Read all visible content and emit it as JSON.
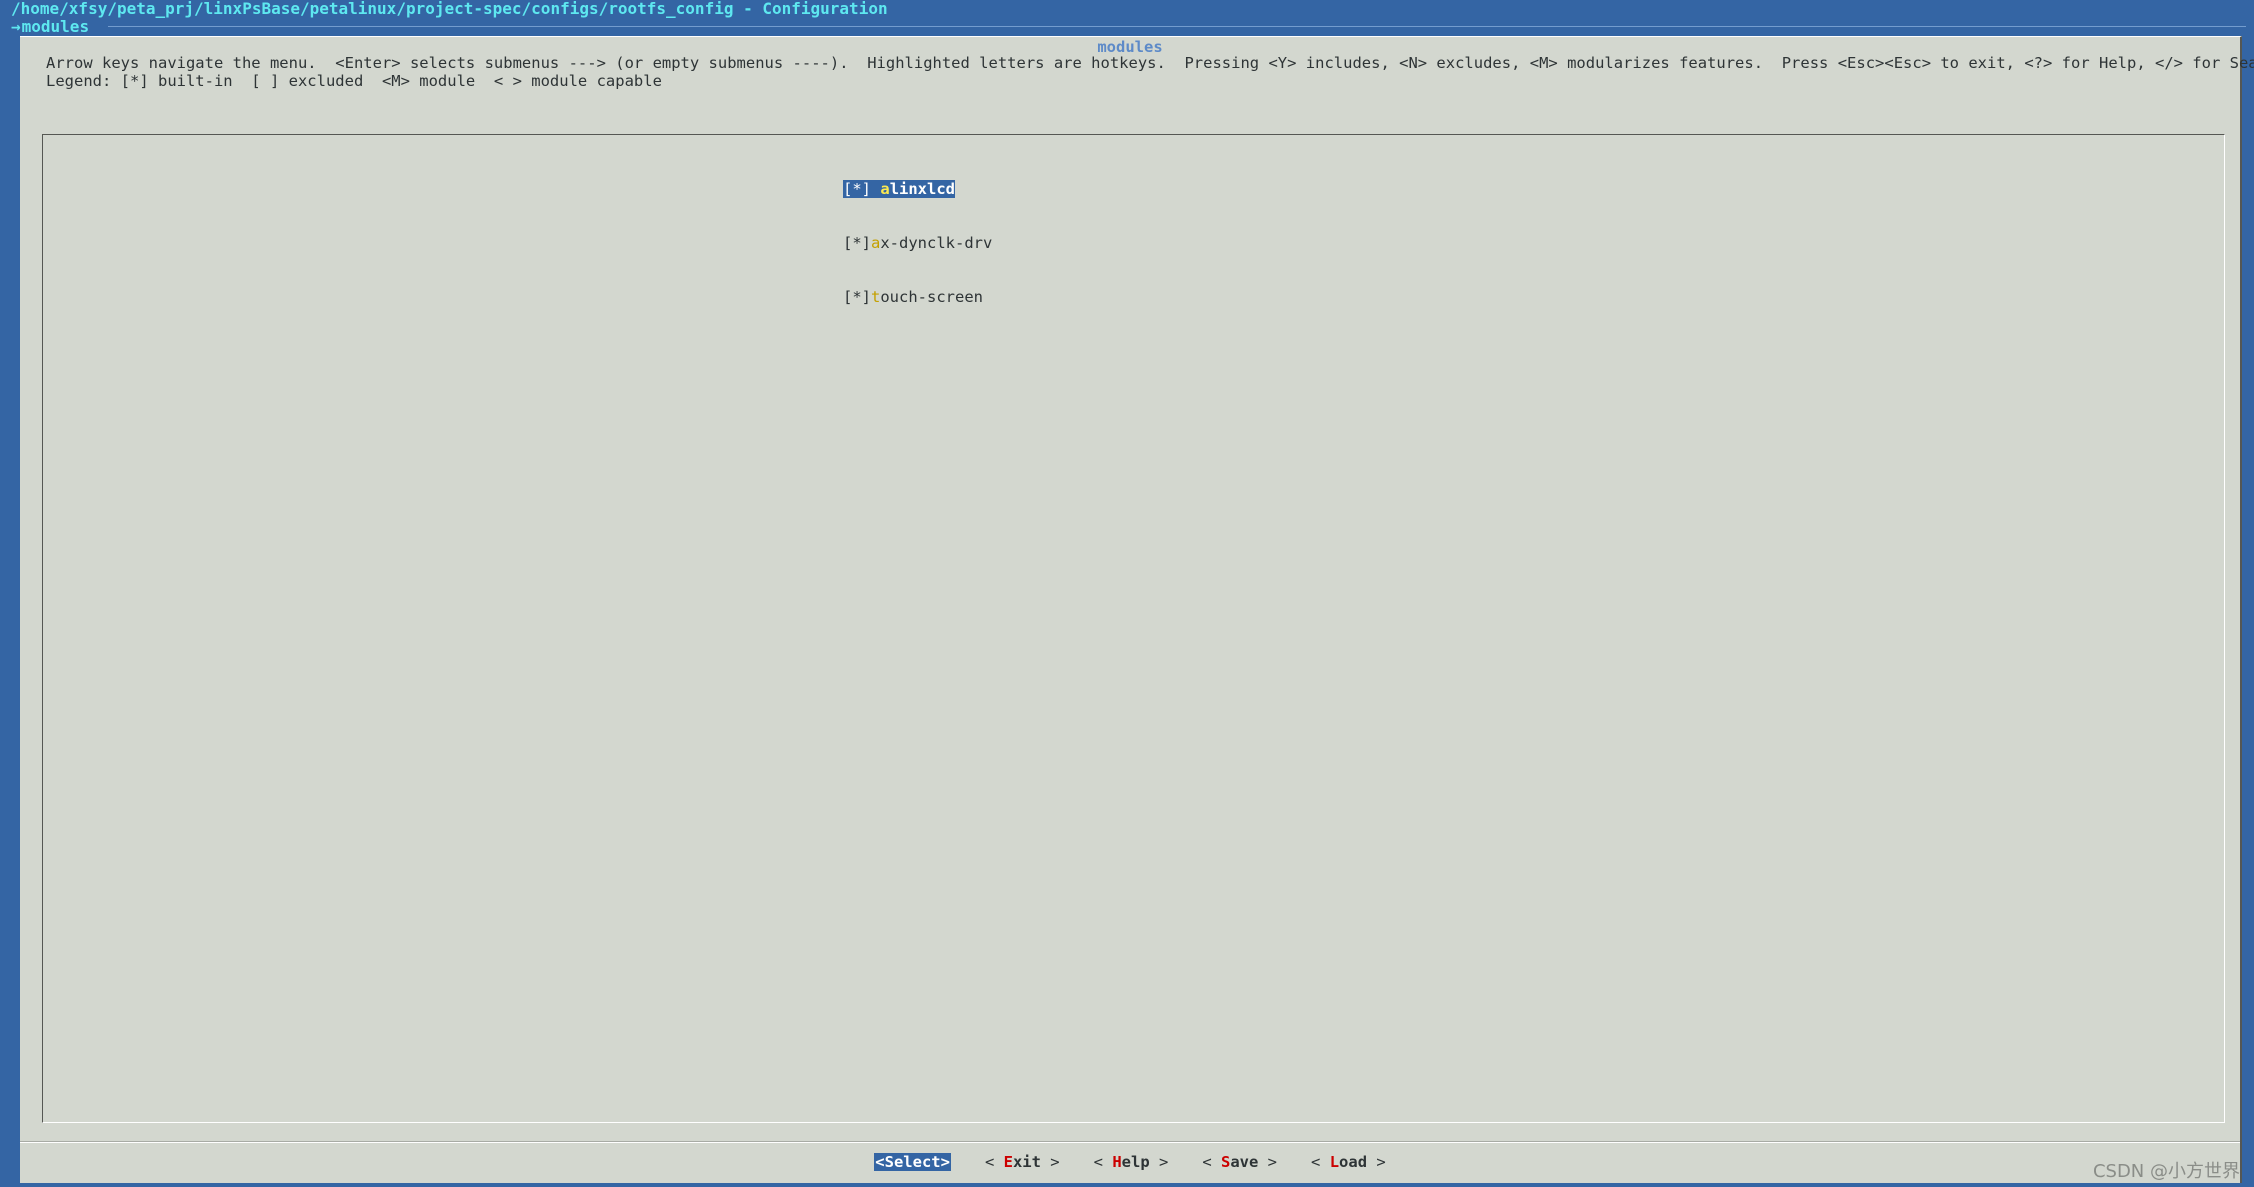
{
  "window": {
    "title": "/home/xfsy/peta_prj/linxPsBase/petalinux/project-spec/configs/rootfs_config - Configuration",
    "breadcrumb_arrow": "→",
    "breadcrumb": "modules"
  },
  "dialog": {
    "title": "modules",
    "help_line1": "Arrow keys navigate the menu.  <Enter> selects submenus ---> (or empty submenus ----).  Highlighted letters are hotkeys.  Pressing <Y> includes, <N> excludes, <M> modularizes features.  Press <Esc><Esc> to exit, <?> for Help, </> for Search.",
    "help_line2": "Legend: [*] built-in  [ ] excluded  <M> module  < > module capable"
  },
  "menu": {
    "items": [
      {
        "state": "[*]",
        "hotkey": "a",
        "rest": "linxlcd",
        "selected": true
      },
      {
        "state": "[*]",
        "hotkey": "a",
        "rest": "x-dynclk-drv",
        "selected": false
      },
      {
        "state": "[*]",
        "hotkey": "t",
        "rest": "ouch-screen",
        "selected": false
      }
    ]
  },
  "buttons": {
    "select": "<Select>",
    "exit_open": "< ",
    "exit_hotkey": "E",
    "exit_rest": "xit",
    "exit_close": " >",
    "help_open": "< ",
    "help_hotkey": "H",
    "help_rest": "elp",
    "help_close": " >",
    "save_open": "< ",
    "save_hotkey": "S",
    "save_rest": "ave",
    "save_close": " >",
    "load_open": "< ",
    "load_hotkey": "L",
    "load_rest": "oad",
    "load_close": " >"
  },
  "watermark": "CSDN @小方世界",
  "colors": {
    "terminal_bg": "#3465a4",
    "dialog_bg": "#d3d7cf",
    "title_text": "#5ee8f0",
    "highlight_bg": "#3465a4",
    "hotkey_menu": "#c4a000",
    "hotkey_button": "#cc0000"
  }
}
